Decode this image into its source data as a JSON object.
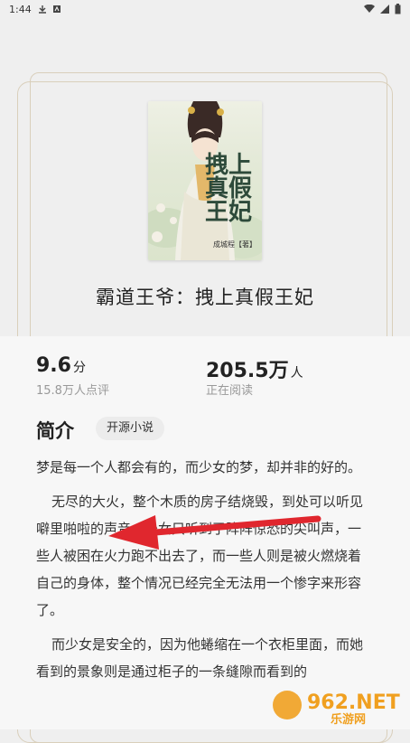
{
  "status_bar": {
    "time": "1:44"
  },
  "book": {
    "cover": {
      "title_art": "拽上真假王妃",
      "author": "成城程【著】"
    },
    "title": "霸道王爷：拽上真假王妃"
  },
  "stats": {
    "score": {
      "value": "9.6",
      "unit": "分",
      "label": "15.8万人点评"
    },
    "readers": {
      "value": "205.5万",
      "unit": "人",
      "label": "正在阅读"
    }
  },
  "intro": {
    "heading": "简介",
    "tag": "开源小说",
    "paragraphs": [
      "梦是每一个人都会有的，而少女的梦，却并非的好的。",
      "无尽的大火，整个木质的房子结烧毁，到处可以听见噼里啪啦的声音，少女只听到了阵阵惊恐的尖叫声，一些人被困在火力跑不出去了，而一些人则是被火燃烧着自己的身体，整个情况已经完全无法用一个惨字来形容了。",
      "而少女是安全的，因为他蜷缩在一个衣柜里面，而她看到的景象则是通过柜子的一条缝隙而看到的"
    ]
  },
  "watermark": {
    "text": "962.NET",
    "subtext": "乐游网"
  },
  "colors": {
    "accent_arrow": "#e0272e",
    "card_border": "#d9cfbb"
  }
}
